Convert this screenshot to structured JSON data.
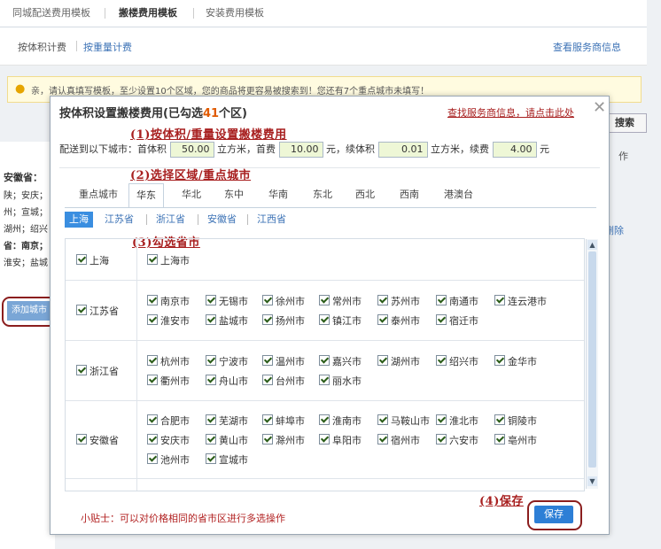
{
  "bg": {
    "tabs": [
      "同城配送费用模板",
      "搬楼费用模板",
      "安装费用模板"
    ],
    "sub_tabs": [
      "按体积计费",
      "按重量计费"
    ],
    "service_link": "查看服务商信息",
    "notice": "亲，请认真填写模板，至少设置10个区域，您的商品将更容易被搜索到！您还有7个重点城市未填写！",
    "left_lines": [
      "安徽省：",
      "陕；安庆；",
      "州；宣城；",
      "湖州；绍兴",
      "省：南京；",
      "淮安；盐城"
    ],
    "add_city": "添加城市",
    "search_btn": "搜索",
    "header_frag": "作",
    "delete": "删除"
  },
  "modal": {
    "title_prefix": "按体积设置搬楼费用(已勾选",
    "title_count": "41",
    "title_suffix": "个区)",
    "find_link": "查找服务商信息，请点击此处",
    "close_icon": "close-icon",
    "note1": "(1)按体积/重量设置搬楼费用",
    "note2": "(2)选择区域/重点城市",
    "note3": "(3)勾选省市",
    "note4": "(4)保存",
    "rule": {
      "prefix": "配送到以下城市：首体积",
      "first_vol": "50.00",
      "unit1": "立方米，首费",
      "first_fee": "10.00",
      "unit2": "元，续体积",
      "cont_vol": "0.01",
      "unit3": "立方米，续费",
      "cont_fee": "4.00",
      "unit4": "元"
    },
    "region_tabs": [
      "重点城市",
      "华东",
      "华北",
      "东中",
      "华南",
      "东北",
      "西北",
      "西南",
      "港澳台"
    ],
    "province_tabs": [
      "上海",
      "江苏省",
      "浙江省",
      "安徽省",
      "江西省"
    ],
    "rows": [
      {
        "province": "上海",
        "cities": [
          "上海市"
        ]
      },
      {
        "province": "江苏省",
        "cities": [
          "南京市",
          "无锡市",
          "徐州市",
          "常州市",
          "苏州市",
          "南通市",
          "连云港市",
          "淮安市",
          "盐城市",
          "扬州市",
          "镇江市",
          "泰州市",
          "宿迁市"
        ]
      },
      {
        "province": "浙江省",
        "cities": [
          "杭州市",
          "宁波市",
          "温州市",
          "嘉兴市",
          "湖州市",
          "绍兴市",
          "金华市",
          "衢州市",
          "舟山市",
          "台州市",
          "丽水市"
        ]
      },
      {
        "province": "安徽省",
        "cities": [
          "合肥市",
          "芜湖市",
          "蚌埠市",
          "淮南市",
          "马鞍山市",
          "淮北市",
          "铜陵市",
          "安庆市",
          "黄山市",
          "滁州市",
          "阜阳市",
          "宿州市",
          "六安市",
          "亳州市",
          "池州市",
          "宣城市"
        ]
      }
    ],
    "tip": "小贴士：可以对价格相同的省市区进行多选操作",
    "save_label": "保存"
  }
}
